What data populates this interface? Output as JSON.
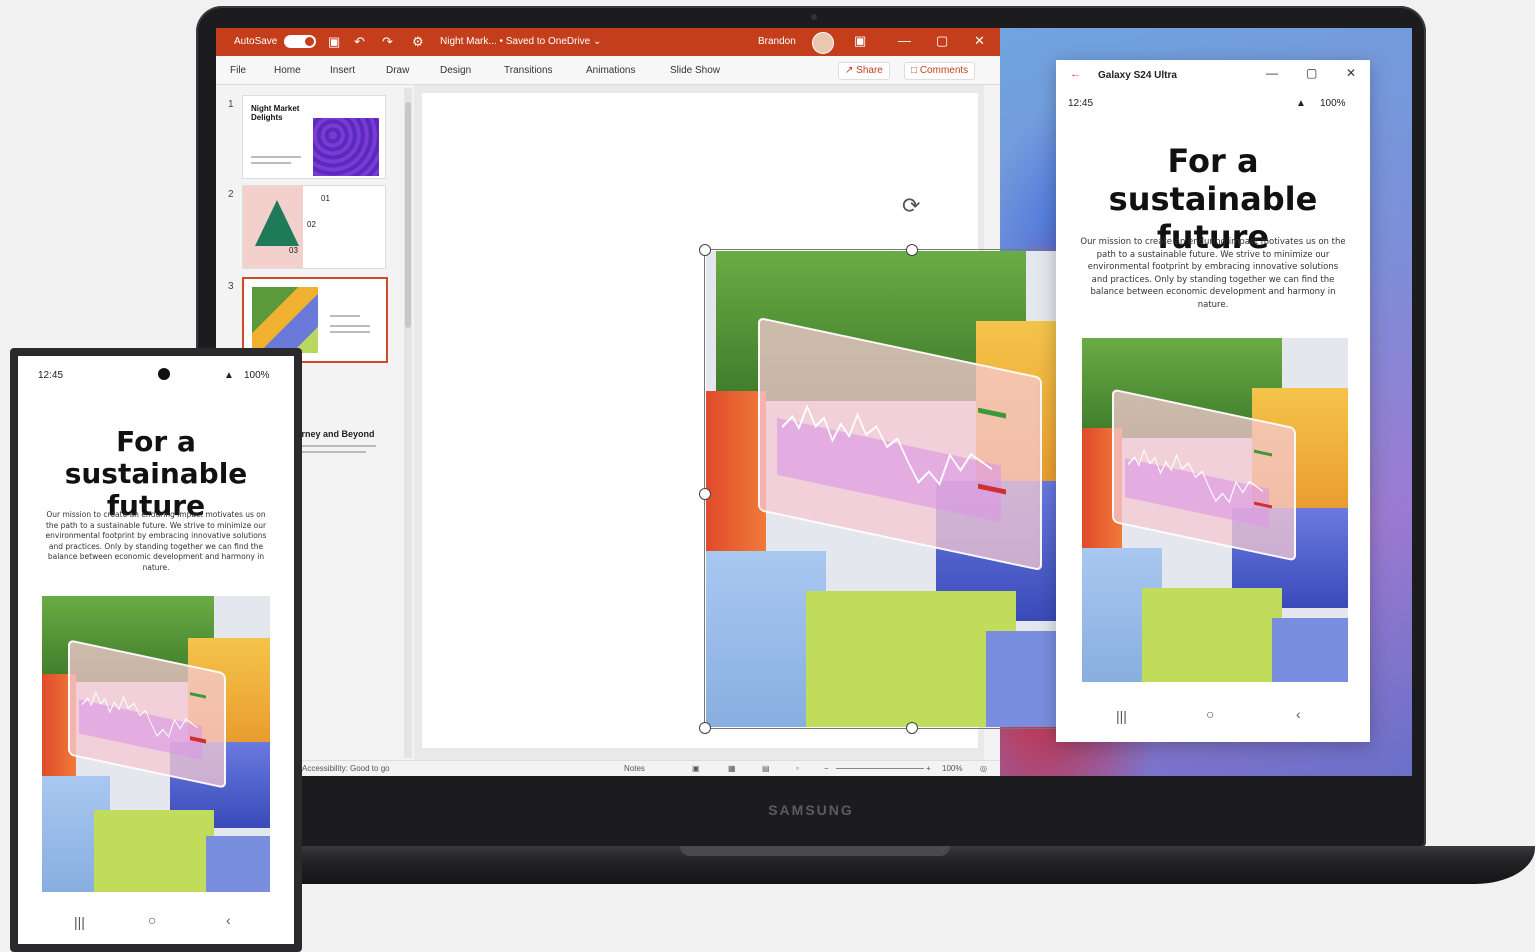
{
  "powerpoint": {
    "autosave_label": "AutoSave",
    "toggle_state": "On",
    "doc_title": "Night Mark... • Saved to OneDrive ⌄",
    "user_name": "Brandon",
    "tabs": [
      "File",
      "Home",
      "Insert",
      "Draw",
      "Design",
      "Transitions",
      "Animations",
      "Slide Show"
    ],
    "share_label": "Share",
    "comments_label": "Comments",
    "thumbnails": [
      {
        "number": "1",
        "title": "Night Market Delights"
      },
      {
        "number": "2",
        "items": [
          "01",
          "02",
          "03"
        ]
      },
      {
        "number": "3",
        "title": ""
      }
    ],
    "partial_thumb_text": "urney and Beyond",
    "status_accessibility": "Accessibility: Good to go",
    "status_notes": "Notes",
    "zoom_level": "100%"
  },
  "phone_link": {
    "title": "Galaxy S24 Ultra",
    "time": "12:45",
    "battery": "100%"
  },
  "content": {
    "heading": "For a sustainable future",
    "body": "Our mission to create an enduring impact motivates us on the path to a sustainable future. We strive to minimize our environmental footprint by embracing innovative solutions and practices. Only by standing together we can find the balance between economic development and harmony in nature."
  },
  "phone": {
    "time": "12:45",
    "battery": "100%"
  },
  "laptop": {
    "brand": "SAMSUNG"
  },
  "colors": {
    "ppt_accent": "#c43e1c",
    "green_block": "#5a9a3a",
    "yellow_block": "#f0b030",
    "blue_block": "#5a6ad8",
    "lime_floor": "#b8d860"
  }
}
